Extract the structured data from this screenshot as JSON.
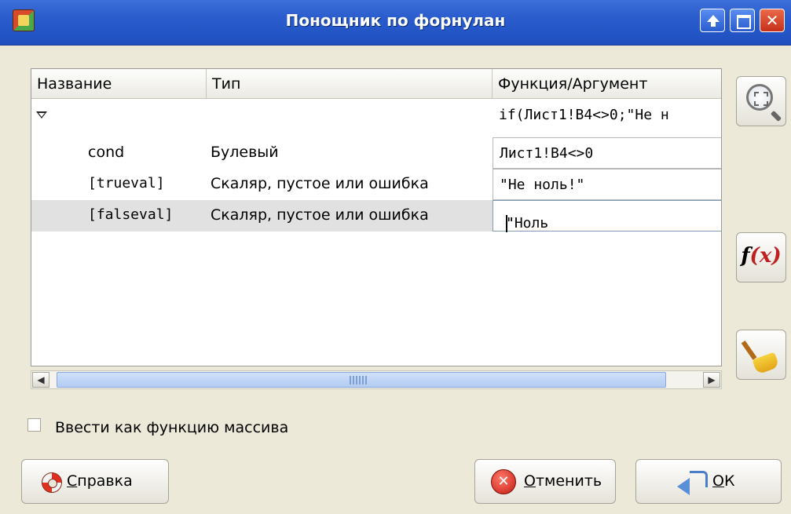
{
  "window": {
    "title": "Понощник по форнулан",
    "app_icon": "calc-app-icon",
    "controls": [
      "shade-up-icon",
      "maximize-icon",
      "close-icon"
    ]
  },
  "table": {
    "columns": [
      "Название",
      "Тип",
      "Функция/Аргумент"
    ],
    "root_row": {
      "expander": "expander-down-icon",
      "value": "if(Лист1!B4<>0;\"Не н"
    },
    "rows": [
      {
        "name": "cond",
        "type": "Булевый",
        "value": "Лист1!B4<>0",
        "selected": false
      },
      {
        "name": "[trueval]",
        "type": "Скаляр, пустое или ошибка",
        "value": "\"Не ноль!\"",
        "selected": false
      },
      {
        "name": "[falseval]",
        "type": "Скаляр, пустое или ошибка",
        "value_before_caret": "\"Ноль",
        "value_after_caret": "\"",
        "selected": true
      }
    ]
  },
  "scrollbar": {
    "left_arrow": "◀",
    "right_arrow": "▶"
  },
  "side_buttons": {
    "zoom": "zoom-icon",
    "fx_label_f": "f",
    "fx_label_open": "(",
    "fx_label_x": "x",
    "fx_label_close": ")",
    "clear": "broom-icon"
  },
  "array_checkbox": {
    "label": "Ввести как функцию массива",
    "checked": false
  },
  "buttons": {
    "help": {
      "mnemonic": "С",
      "rest": "правка"
    },
    "cancel": {
      "mnemonic": "О",
      "rest": "тменить"
    },
    "ok": {
      "mnemonic": "О",
      "rest": "К"
    }
  }
}
